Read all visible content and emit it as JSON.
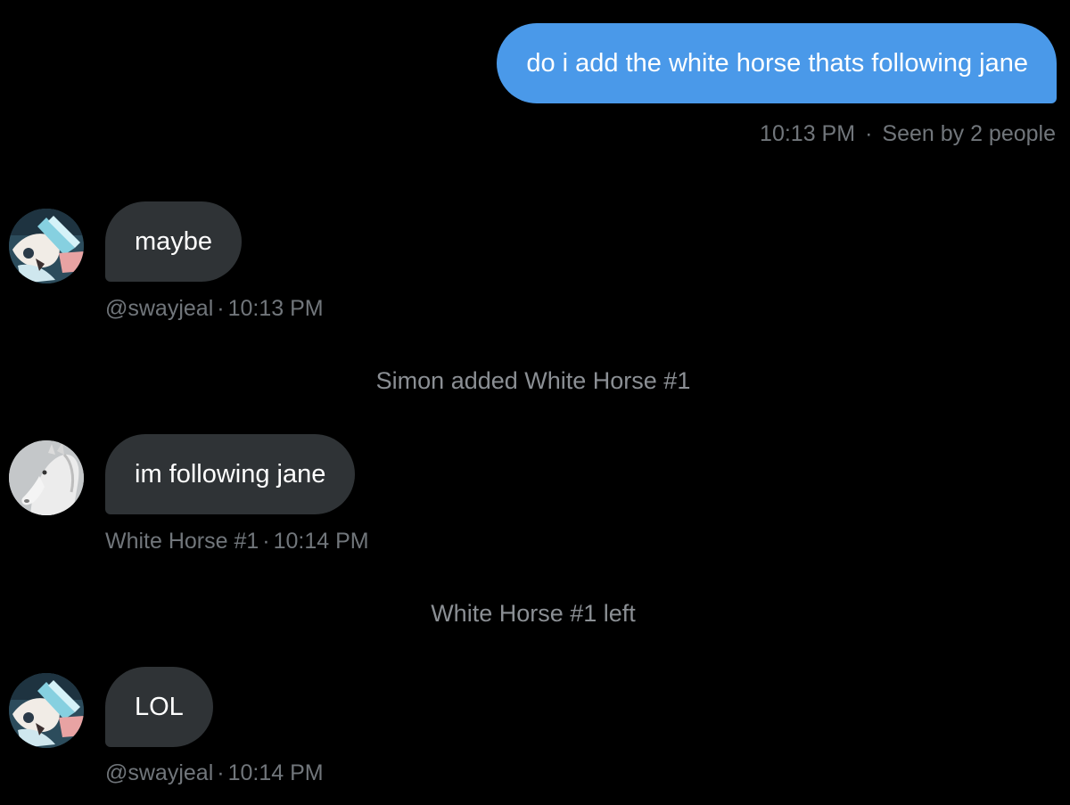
{
  "messages": {
    "outgoing": {
      "text": "do i add the white horse thats following jane",
      "time": "10:13 PM",
      "separator": "·",
      "status": "Seen by 2 people"
    },
    "incoming": [
      {
        "text": "maybe",
        "author": "@swayjeal",
        "separator": "·",
        "time": "10:13 PM",
        "avatar": "anime-character-avatar"
      },
      {
        "text": "im following jane",
        "author": "White Horse #1",
        "separator": "·",
        "time": "10:14 PM",
        "avatar": "white-horse-avatar"
      },
      {
        "text": "LOL",
        "author": "@swayjeal",
        "separator": "·",
        "time": "10:14 PM",
        "avatar": "anime-character-avatar"
      }
    ],
    "system": [
      {
        "text": "Simon added White Horse #1"
      },
      {
        "text": "White Horse #1 left"
      }
    ]
  },
  "colors": {
    "background": "#000000",
    "outgoing_bubble": "#4a99e9",
    "incoming_bubble": "#2f3336",
    "meta_text": "#71767b",
    "message_text": "#ffffff"
  }
}
